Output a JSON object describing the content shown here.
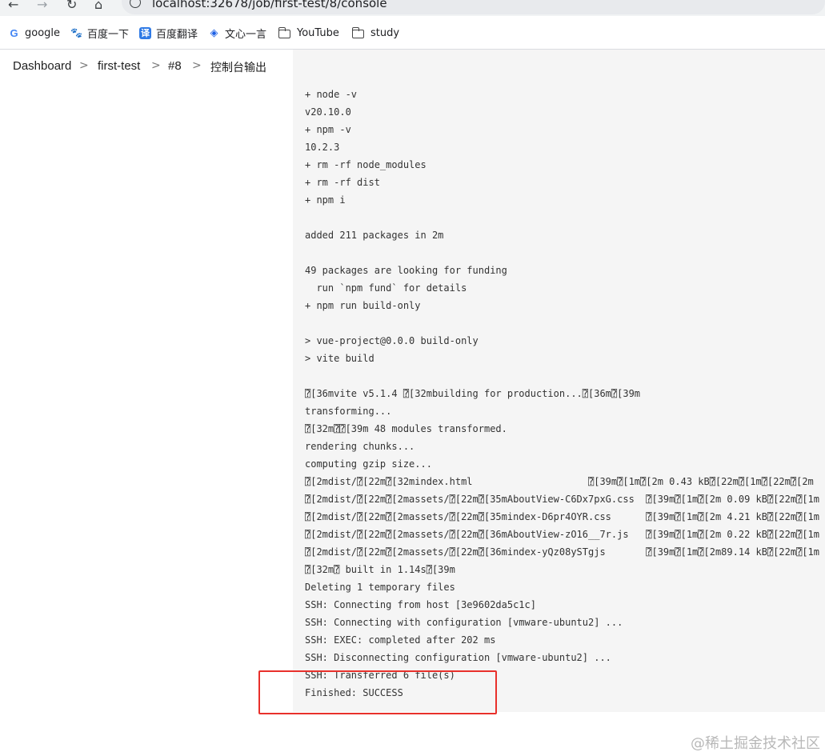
{
  "browser": {
    "url": "localhost:32678/job/first-test/8/console",
    "bookmarks": [
      {
        "label": "google",
        "icon": "google-icon",
        "glyph": "G"
      },
      {
        "label": "百度一下",
        "icon": "baidu-paw-icon",
        "glyph": "🐾"
      },
      {
        "label": "百度翻译",
        "icon": "translate-icon",
        "glyph": "译"
      },
      {
        "label": "文心一言",
        "icon": "wenxin-icon",
        "glyph": "◈"
      },
      {
        "label": "YouTube",
        "icon": "folder-icon"
      },
      {
        "label": "study",
        "icon": "folder-icon"
      }
    ]
  },
  "breadcrumb": {
    "items": [
      "Dashboard",
      "first-test",
      "#8",
      "控制台输出"
    ],
    "separator": ">"
  },
  "console": {
    "lines": [
      "+ node -v",
      "v20.10.0",
      "+ npm -v",
      "10.2.3",
      "+ rm -rf node_modules",
      "+ rm -rf dist",
      "+ npm i",
      "",
      "added 211 packages in 2m",
      "",
      "49 packages are looking for funding",
      "  run `npm fund` for details",
      "+ npm run build-only",
      "",
      "> vue-project@0.0.0 build-only",
      "> vite build",
      "",
      "⍰[36mvite v5.1.4 ⍰[32mbuilding for production...⍰[36m⍰[39m",
      "transforming...",
      "⍰[32m⍰⍰[39m 48 modules transformed.",
      "rendering chunks...",
      "computing gzip size...",
      "⍰[2mdist/⍰[22m⍰[32mindex.html                    ⍰[39m⍰[1m⍰[2m 0.43 kB⍰[22m⍰[1m⍰[22m⍰[2m",
      "⍰[2mdist/⍰[22m⍰[2massets/⍰[22m⍰[35mAboutView-C6Dx7pxG.css  ⍰[39m⍰[1m⍰[2m 0.09 kB⍰[22m⍰[1m",
      "⍰[2mdist/⍰[22m⍰[2massets/⍰[22m⍰[35mindex-D6pr4OYR.css      ⍰[39m⍰[1m⍰[2m 4.21 kB⍰[22m⍰[1m",
      "⍰[2mdist/⍰[22m⍰[2massets/⍰[22m⍰[36mAboutView-zO16__7r.js   ⍰[39m⍰[1m⍰[2m 0.22 kB⍰[22m⍰[1m",
      "⍰[2mdist/⍰[22m⍰[2massets/⍰[22m⍰[36mindex-yQz08ySTgjs       ⍰[39m⍰[1m⍰[2m89.14 kB⍰[22m⍰[1m",
      "⍰[32m⍰ built in 1.14s⍰[39m",
      "Deleting 1 temporary files",
      "SSH: Connecting from host [3e9602da5c1c]",
      "SSH: Connecting with configuration [vmware-ubuntu2] ...",
      "SSH: EXEC: completed after 202 ms",
      "SSH: Disconnecting configuration [vmware-ubuntu2] ...",
      "SSH: Transferred 6 file(s)",
      "Finished: SUCCESS"
    ]
  },
  "watermark": "@稀土掘金技术社区",
  "colors": {
    "highlight": "#e8302b",
    "console_bg": "#f5f5f5"
  }
}
